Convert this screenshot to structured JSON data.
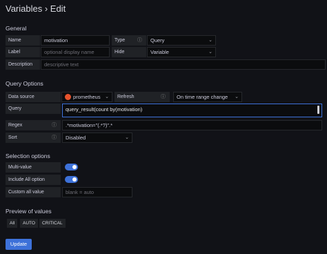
{
  "header": {
    "title": "Variables › Edit"
  },
  "general": {
    "heading": "General",
    "name_label": "Name",
    "name_value": "motivation",
    "type_label": "Type",
    "type_value": "Query",
    "label_label": "Label",
    "label_placeholder": "optional display name",
    "hide_label": "Hide",
    "hide_value": "Variable",
    "description_label": "Description",
    "description_placeholder": "descriptive text"
  },
  "query_options": {
    "heading": "Query Options",
    "datasource_label": "Data source",
    "datasource_value": "prometheus",
    "refresh_label": "Refresh",
    "refresh_value": "On time range change",
    "query_label": "Query",
    "query_value": "query_result(count by(motivation)",
    "regex_label": "Regex",
    "regex_value": ".*motivation=\"(.*?)\".*",
    "sort_label": "Sort",
    "sort_value": "Disabled"
  },
  "selection_options": {
    "heading": "Selection options",
    "multi_value_label": "Multi-value",
    "multi_value_on": true,
    "include_all_label": "Include All option",
    "include_all_on": true,
    "custom_all_label": "Custom all value",
    "custom_all_placeholder": "blank = auto"
  },
  "preview": {
    "heading": "Preview of values",
    "values": [
      "All",
      "AUTO",
      "CRITICAL"
    ]
  },
  "actions": {
    "update_label": "Update"
  },
  "icons": {
    "info": "info-icon",
    "chevron": "chevron-down-icon",
    "datasource": "prometheus-icon"
  },
  "colors": {
    "accent": "#3d71d9",
    "background": "#111217",
    "prometheus": "#e6522c"
  }
}
